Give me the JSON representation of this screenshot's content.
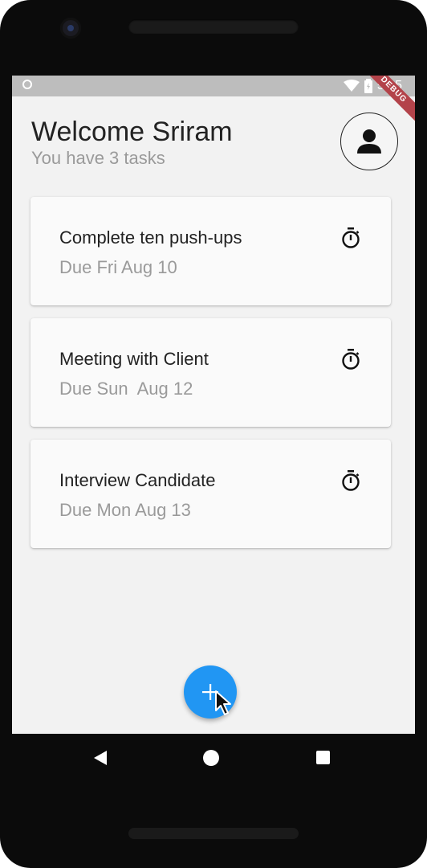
{
  "status_bar": {
    "time": "5:05",
    "icons": [
      "circle-notification-icon",
      "wifi-icon",
      "battery-icon"
    ],
    "debug_label": "DEBUG"
  },
  "header": {
    "title": "Welcome Sriram",
    "subtitle": "You have 3 tasks"
  },
  "tasks": [
    {
      "title": "Complete ten push-ups",
      "due": "Due Fri Aug 10",
      "icon": "timer-icon"
    },
    {
      "title": "Meeting with Client",
      "due": "Due Sun  Aug 12",
      "icon": "timer-icon"
    },
    {
      "title": "Interview Candidate",
      "due": "Due Mon Aug 13",
      "icon": "timer-icon"
    }
  ],
  "fab": {
    "icon": "plus-icon",
    "color": "#2196f3"
  },
  "nav": {
    "icons": [
      "back-icon",
      "home-icon",
      "recent-apps-icon"
    ]
  },
  "colors": {
    "screen_background": "#f2f2f2",
    "card_background": "#fafafa",
    "title_text": "#222222",
    "muted_text": "#9a9a9a",
    "status_bar": "#bdbdbd",
    "debug_ribbon": "#b3434a"
  }
}
